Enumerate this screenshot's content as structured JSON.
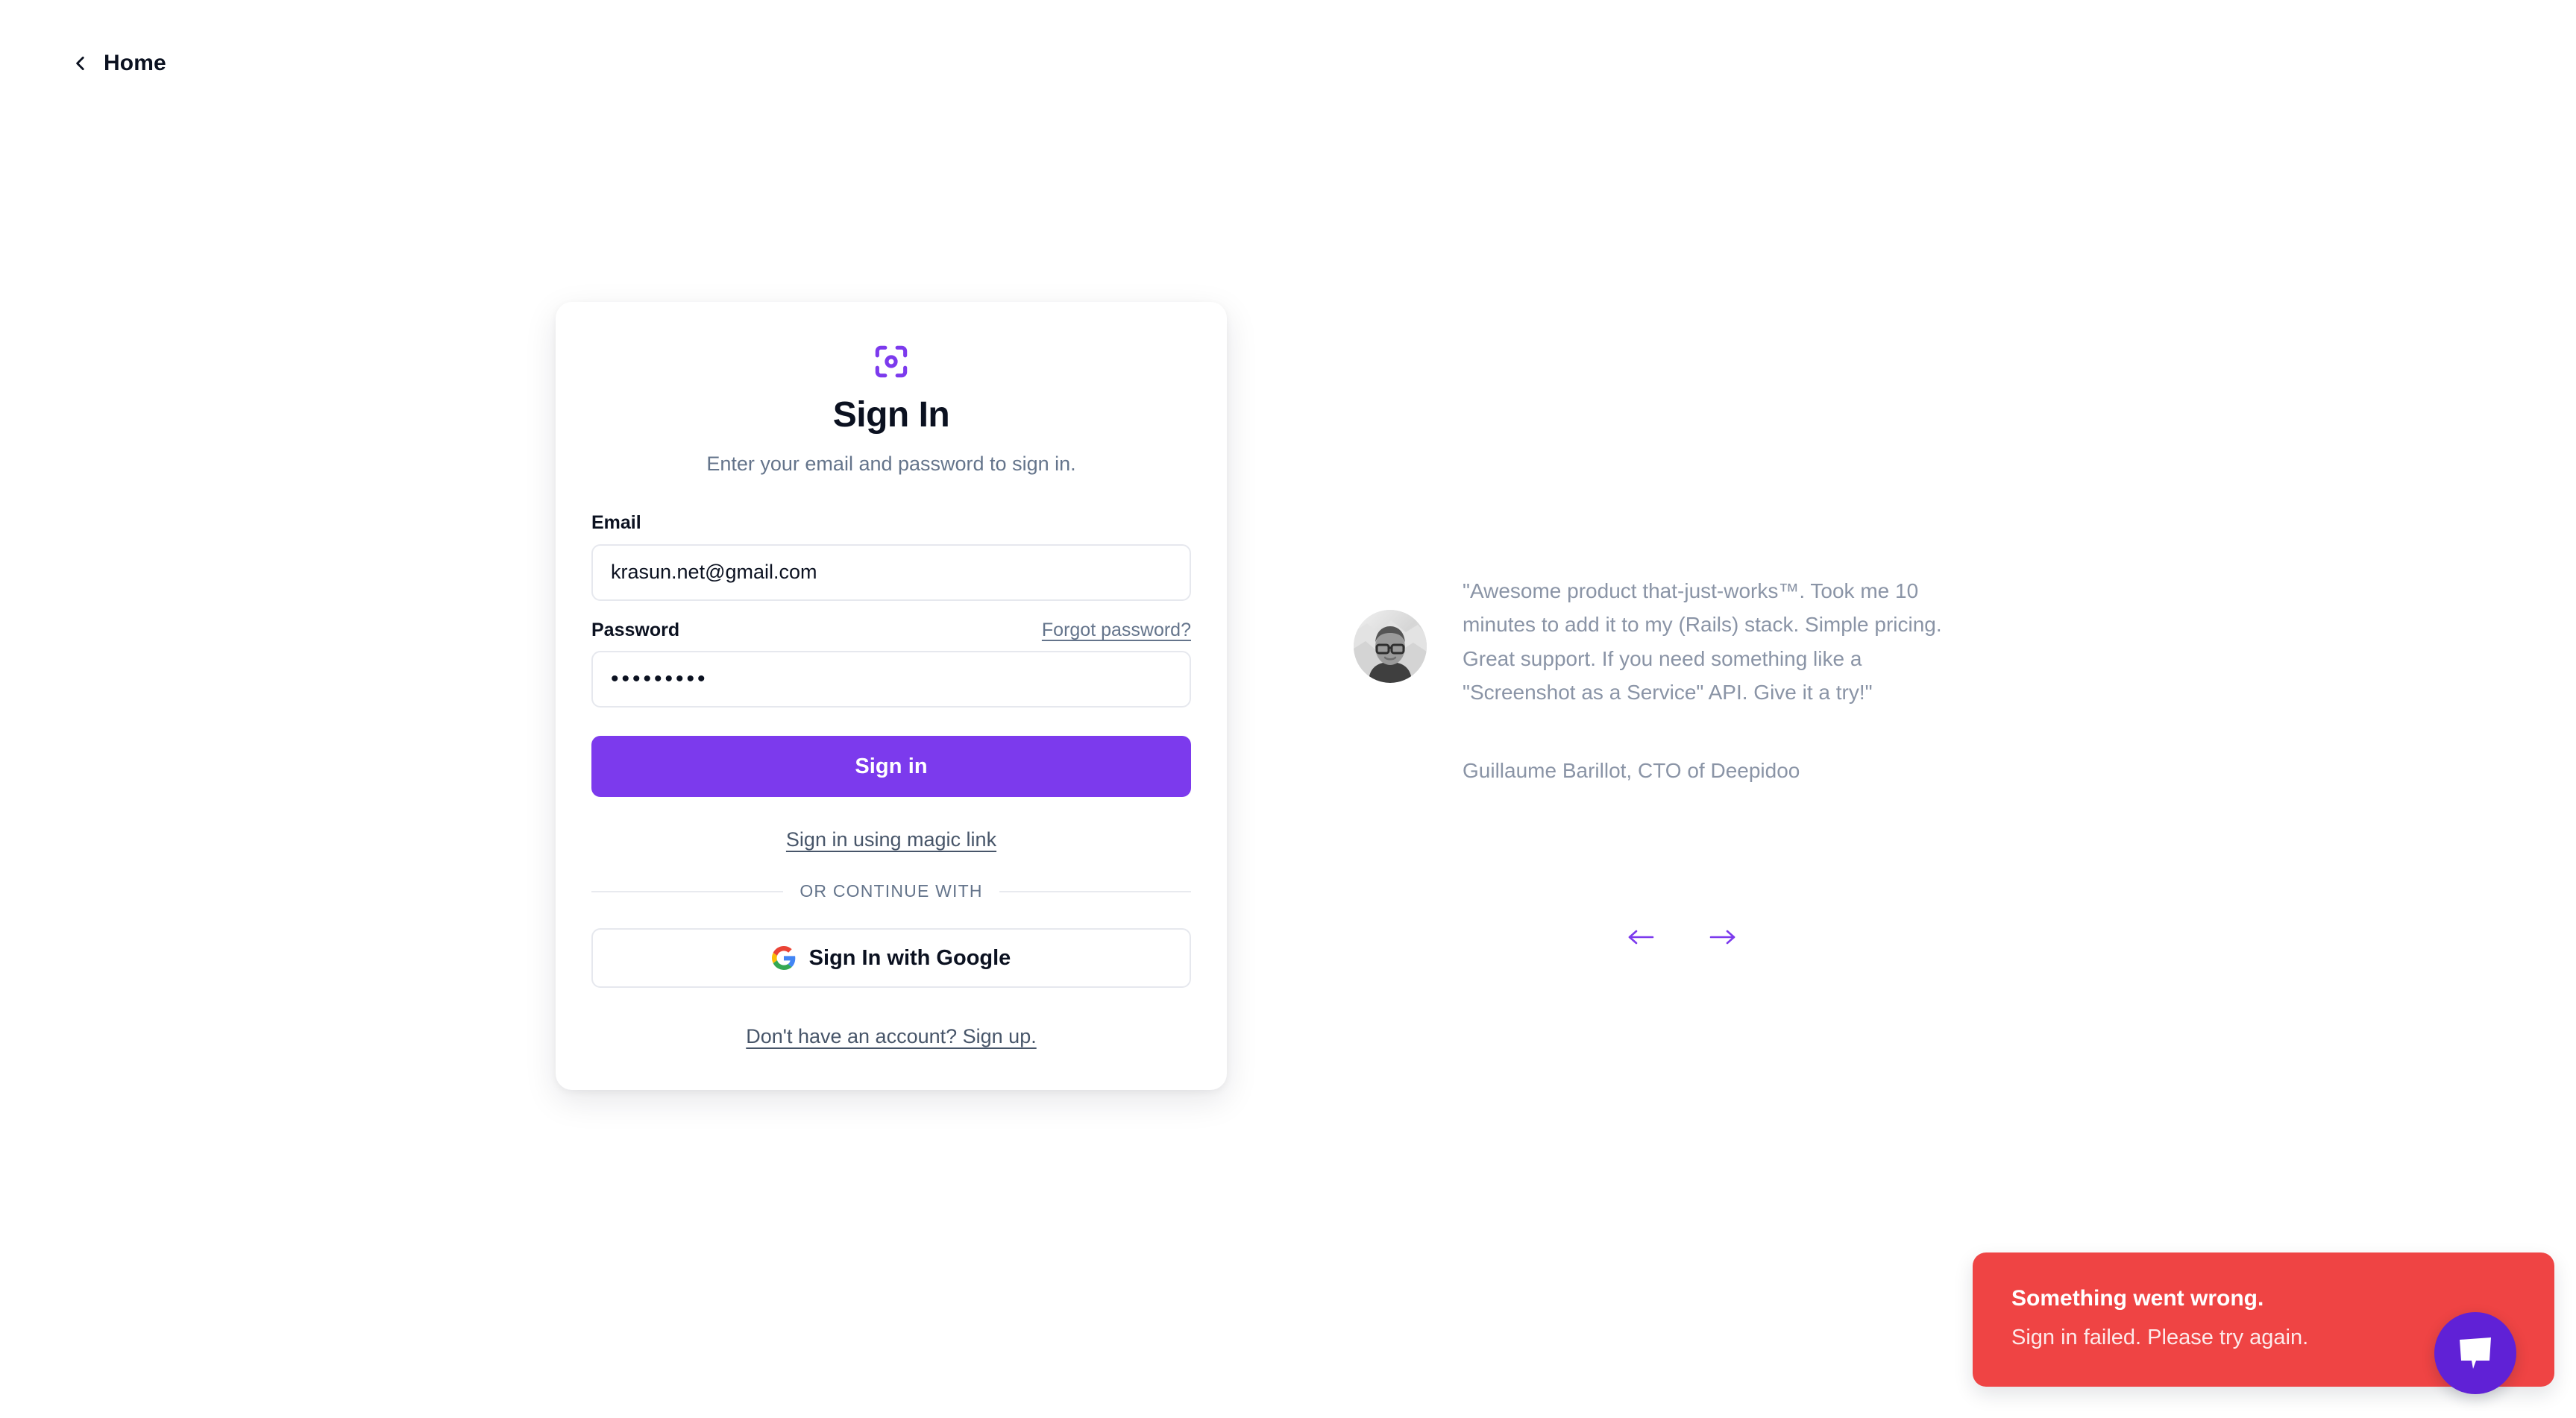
{
  "nav": {
    "back_label": "Home",
    "back_icon": "chevron-left-icon"
  },
  "card": {
    "logo_icon": "scan-focus-icon",
    "title": "Sign In",
    "subtitle": "Enter your email and password to sign in.",
    "email": {
      "label": "Email",
      "value": "krasun.net@gmail.com",
      "placeholder": "Email"
    },
    "password": {
      "label": "Password",
      "forgot_label": "Forgot password?",
      "value": "•••••••••",
      "placeholder": "Password"
    },
    "submit_label": "Sign in",
    "magic_link_label": "Sign in using magic link",
    "divider_label": "OR CONTINUE WITH",
    "google_label": "Sign In with Google",
    "google_icon": "google-g-icon",
    "signup_label": "Don't have an account? Sign up."
  },
  "testimonial": {
    "quote": "\"Awesome product that-just-works™. Took me 10 minutes to add it to my (Rails) stack. Simple pricing. Great support. If you need something like a \"Screenshot as a Service\" API. Give it a try!\"",
    "author": "Guillaume Barillot, CTO of Deepidoo",
    "avatar_alt": "avatar",
    "prev_icon": "arrow-left-icon",
    "next_icon": "arrow-right-icon"
  },
  "toast": {
    "title": "Something went wrong.",
    "message": "Sign in failed. Please try again."
  },
  "chat": {
    "icon": "chat-bubble-icon"
  },
  "colors": {
    "accent": "#7c3aed",
    "chat_accent": "#6021d6",
    "error": "#ef4444",
    "text_primary": "#0b1120",
    "text_muted": "#64748b",
    "text_quote": "#8a94a6",
    "border": "#e6e8ee"
  }
}
